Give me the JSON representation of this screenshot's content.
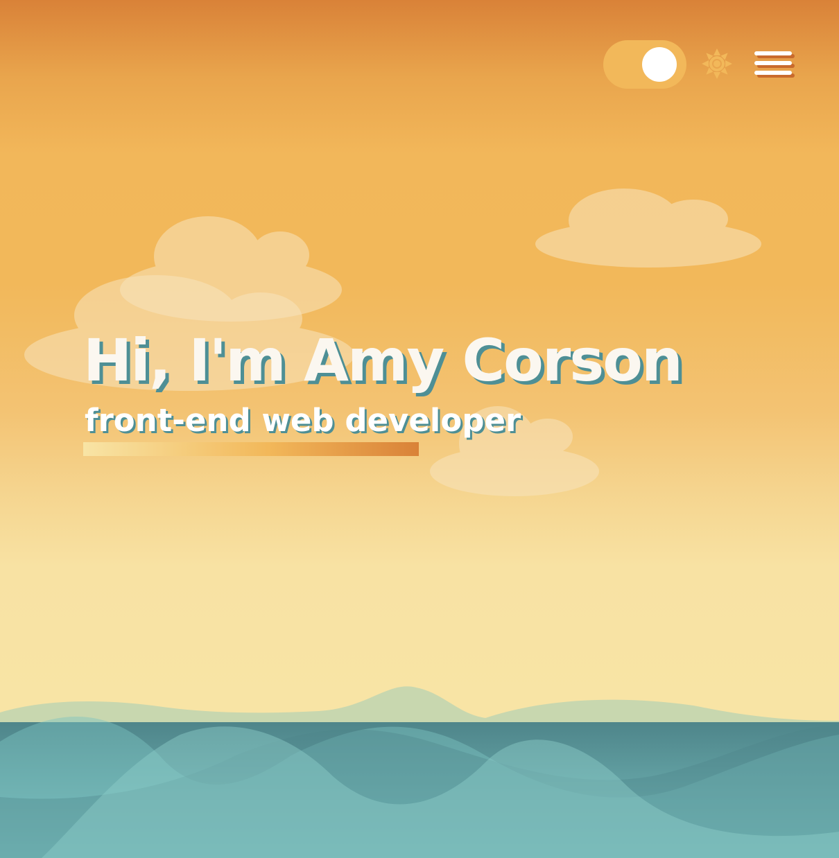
{
  "header": {
    "theme_toggle": {
      "state": "light"
    },
    "theme_icon": "sun-icon",
    "menu_icon": "hamburger-menu-icon"
  },
  "hero": {
    "title": "Hi, I'm Amy Corson",
    "subtitle": "front-end web developer"
  },
  "colors": {
    "sky_top": "#d98238",
    "sky_mid": "#f2b85a",
    "sky_bottom": "#f8e4a5",
    "toggle_track": "#f2b85a",
    "toggle_knob": "#ffffff",
    "text": "#fbf7f0",
    "text_shadow": "#4e8f95",
    "sea_dark": "#4e858a",
    "sea_light": "#7cc3c2",
    "cloud": "#f8e4bd"
  }
}
